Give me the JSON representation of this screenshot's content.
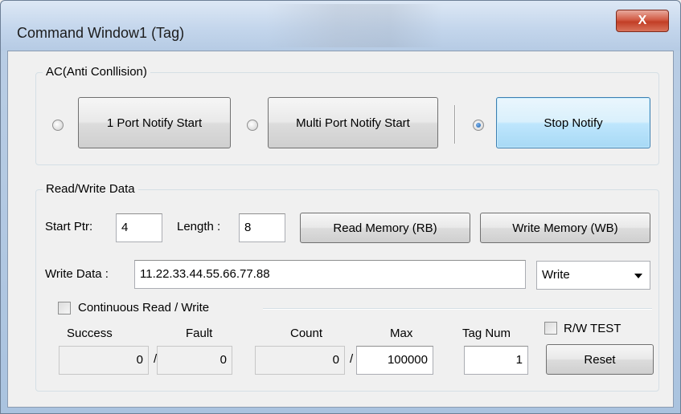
{
  "window": {
    "title": "Command Window1 (Tag)",
    "close_icon": "close-icon",
    "close_label": "X"
  },
  "ac_group": {
    "title": "AC(Anti Conllision)",
    "options": [
      {
        "label": "1 Port Notify Start",
        "checked": false
      },
      {
        "label": "Multi Port Notify Start",
        "checked": false
      },
      {
        "label": "Stop Notify",
        "checked": true
      }
    ]
  },
  "rw_group": {
    "title": "Read/Write Data",
    "start_ptr_label": "Start Ptr:",
    "start_ptr_value": "4",
    "length_label": "Length :",
    "length_value": "8",
    "read_button": "Read Memory (RB)",
    "write_button": "Write Memory (WB)",
    "write_data_label": "Write Data :",
    "write_data_value": "11.22.33.44.55.66.77.88",
    "mode_select": {
      "selected": "Write",
      "icon": "chevron-down-icon"
    },
    "continuous_label": "Continuous Read / Write",
    "continuous_checked": false,
    "stats": {
      "success_label": "Success",
      "success_value": "0",
      "fault_label": "Fault",
      "fault_value": "0",
      "count_label": "Count",
      "count_value": "0",
      "max_label": "Max",
      "max_value": "100000",
      "separator": "/",
      "tagnum_label": "Tag Num",
      "tagnum_value": "1"
    },
    "rw_test_label": "R/W TEST",
    "rw_test_checked": false,
    "reset_button": "Reset"
  },
  "colors": {
    "active_button": "#bee6fd",
    "close_button": "#c94a33",
    "window_frame": "#b9cde4"
  }
}
